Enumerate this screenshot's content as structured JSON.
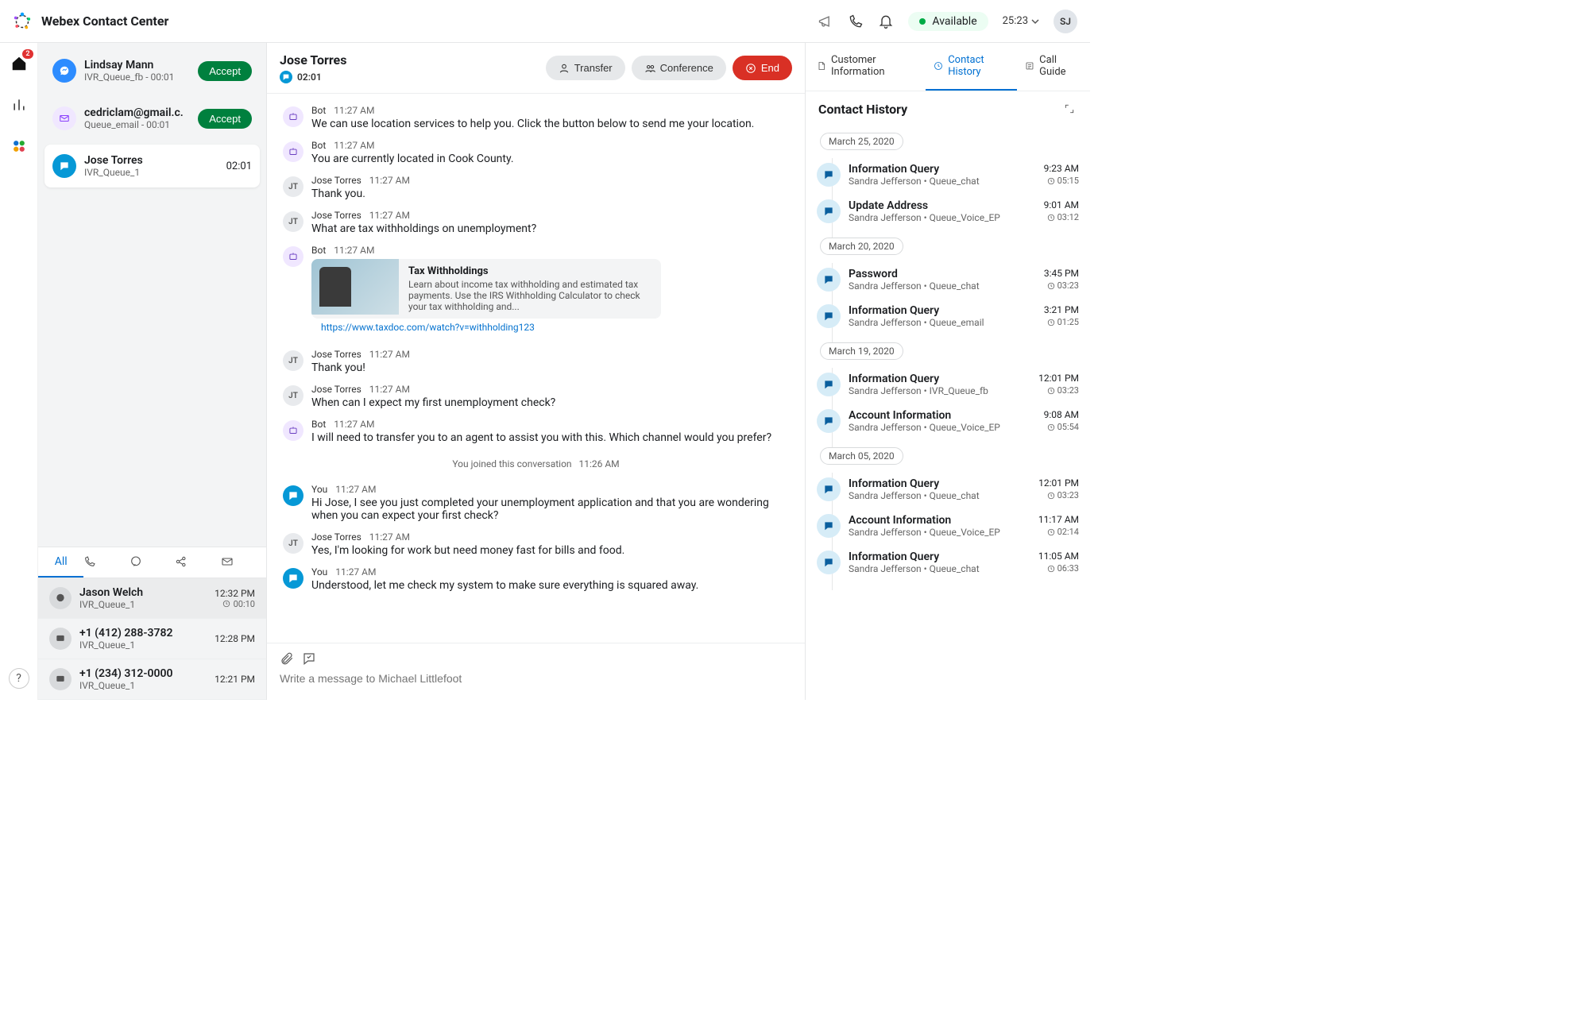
{
  "brand": {
    "title": "Webex Contact Center"
  },
  "topbar": {
    "status": "Available",
    "timer": "25:23",
    "avatar_initials": "SJ"
  },
  "rail": {
    "home_badge": "2"
  },
  "tasks": [
    {
      "name": "Lindsay Mann",
      "meta": "IVR_Queue_fb - 00:01",
      "action": "Accept",
      "type": "fb"
    },
    {
      "name": "cedriclam@gmail.c.",
      "meta": "Queue_email - 00:01",
      "action": "Accept",
      "type": "email"
    },
    {
      "name": "Jose Torres",
      "meta": "IVR_Queue_1",
      "timer": "02:01",
      "type": "chat",
      "active": true
    }
  ],
  "recent_tabs": {
    "all": "All"
  },
  "recent": [
    {
      "name": "Jason Welch",
      "meta": "IVR_Queue_1",
      "time": "12:32 PM",
      "dur": "00:10"
    },
    {
      "name": "+1 (412) 288-3782",
      "meta": "IVR_Queue_1",
      "time": "12:28 PM"
    },
    {
      "name": "+1 (234) 312-0000",
      "meta": "IVR_Queue_1",
      "time": "12:21 PM"
    }
  ],
  "conversation": {
    "title": "Jose Torres",
    "sub_timer": "02:01",
    "actions": {
      "transfer": "Transfer",
      "conference": "Conference",
      "end": "End"
    },
    "card": {
      "title": "Tax Withholdings",
      "desc": "Learn about income tax withholding and estimated tax payments. Use the IRS Withholding Calculator to check your tax withholding and...",
      "link": "https://www.taxdoc.com/watch?v=withholding123"
    },
    "system": {
      "text": "You joined this conversation",
      "time": "11:26 AM"
    },
    "messages": [
      {
        "sender": "Bot",
        "kind": "bot",
        "time": "11:27 AM",
        "body": "We can use location services to help you.  Click the button below to send me your location."
      },
      {
        "sender": "Bot",
        "kind": "bot",
        "time": "11:27 AM",
        "body": "You are currently located in Cook County."
      },
      {
        "sender": "Jose Torres",
        "kind": "user",
        "time": "11:27 AM",
        "body": "Thank you."
      },
      {
        "sender": "Jose Torres",
        "kind": "user",
        "time": "11:27 AM",
        "body": "What are tax withholdings on unemployment?"
      },
      {
        "sender": "Bot",
        "kind": "bot",
        "time": "11:27 AM",
        "card": true
      },
      {
        "sender": "Jose Torres",
        "kind": "user",
        "time": "11:27 AM",
        "body": "Thank you!"
      },
      {
        "sender": "Jose Torres",
        "kind": "user",
        "time": "11:27 AM",
        "body": "When can I expect my first unemployment check?"
      },
      {
        "sender": "Bot",
        "kind": "bot",
        "time": "11:27 AM",
        "body": "I will need to transfer you to an agent to assist you with this.  Which channel would you prefer?"
      },
      {
        "system": true
      },
      {
        "sender": "You",
        "kind": "you",
        "time": "11:27 AM",
        "body": "Hi Jose, I see you just completed your unemployment application and that you are wondering when you can expect your first check?"
      },
      {
        "sender": "Jose Torres",
        "kind": "user",
        "time": "11:27 AM",
        "body": "Yes, I'm looking for work but need money fast for bills and food."
      },
      {
        "sender": "You",
        "kind": "you",
        "time": "11:27 AM",
        "body": "Understood, let me check my system to make sure everything is squared away."
      }
    ],
    "composer_placeholder": "Write a message to Michael Littlefoot"
  },
  "right_tabs": {
    "customer_info": "Customer Information",
    "contact_history": "Contact History",
    "call_guide": "Call Guide"
  },
  "history": {
    "title": "Contact History",
    "groups": [
      {
        "date": "March 25, 2020",
        "items": [
          {
            "title": "Information Query",
            "agent": "Sandra Jefferson",
            "queue": "Queue_chat",
            "time": "9:23 AM",
            "dur": "05:15"
          },
          {
            "title": "Update Address",
            "agent": "Sandra Jefferson",
            "queue": "Queue_Voice_EP",
            "time": "9:01 AM",
            "dur": "03:12"
          }
        ]
      },
      {
        "date": "March 20, 2020",
        "items": [
          {
            "title": "Password",
            "agent": "Sandra Jefferson",
            "queue": "Queue_chat",
            "time": "3:45 PM",
            "dur": "03:23"
          },
          {
            "title": "Information Query",
            "agent": "Sandra Jefferson",
            "queue": "Queue_email",
            "time": "3:21 PM",
            "dur": "01:25"
          }
        ]
      },
      {
        "date": "March 19, 2020",
        "items": [
          {
            "title": "Information Query",
            "agent": "Sandra Jefferson",
            "queue": "IVR_Queue_fb",
            "time": "12:01 PM",
            "dur": "03:23"
          },
          {
            "title": "Account Information",
            "agent": "Sandra Jefferson",
            "queue": "Queue_Voice_EP",
            "time": "9:08 AM",
            "dur": "05:54"
          }
        ]
      },
      {
        "date": "March 05, 2020",
        "items": [
          {
            "title": "Information Query",
            "agent": "Sandra Jefferson",
            "queue": "Queue_chat",
            "time": "12:01 PM",
            "dur": "03:23"
          },
          {
            "title": "Account Information",
            "agent": "Sandra Jefferson",
            "queue": "Queue_Voice_EP",
            "time": "11:17 AM",
            "dur": "02:14"
          },
          {
            "title": "Information Query",
            "agent": "Sandra Jefferson",
            "queue": "Queue_chat",
            "time": "11:05 AM",
            "dur": "06:33"
          }
        ]
      }
    ]
  }
}
